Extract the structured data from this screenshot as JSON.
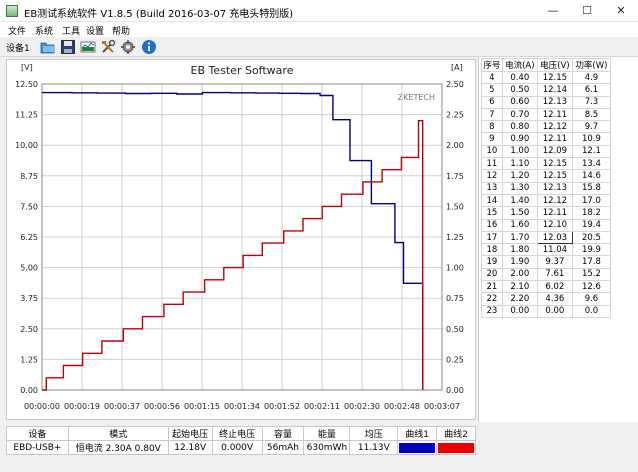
{
  "window": {
    "title": "EB测试系统软件 V1.8.5 (Build 2016-03-07 充电头特别版)",
    "minimize": "—",
    "maximize": "☐",
    "close": "✕"
  },
  "menu": [
    "文件",
    "系统",
    "工具",
    "设置",
    "帮助"
  ],
  "toolbar": {
    "device_label": "设备1",
    "buttons": [
      "open-icon",
      "save-icon",
      "chart-icon",
      "tools-icon",
      "settings-icon",
      "info-icon"
    ]
  },
  "chart_data": {
    "type": "line",
    "title": "EB Tester Software",
    "watermark": "ZKETECH",
    "y_left_unit": "[V]",
    "y_right_unit": "[A]",
    "y_left_ticks": [
      "0.00",
      "1.25",
      "2.50",
      "3.75",
      "5.00",
      "6.25",
      "7.50",
      "8.75",
      "10.00",
      "11.25",
      "12.50"
    ],
    "y_right_ticks": [
      "0.00",
      "0.25",
      "0.50",
      "0.75",
      "1.00",
      "1.25",
      "1.50",
      "1.75",
      "2.00",
      "2.25",
      "2.50"
    ],
    "x_ticks": [
      "00:00:00",
      "00:00:19",
      "00:00:37",
      "00:00:56",
      "00:01:15",
      "00:01:34",
      "00:01:52",
      "00:02:11",
      "00:02:30",
      "00:02:48",
      "00:03:07"
    ],
    "ylim_left": [
      0,
      12.5
    ],
    "ylim_right": [
      0,
      2.5
    ],
    "xlim_seconds": [
      0,
      187
    ],
    "grid": true,
    "series": [
      {
        "color": "#000080",
        "axis": "left",
        "x": [
          0,
          14,
          26,
          39,
          51,
          63,
          75,
          88,
          100,
          111,
          121,
          130,
          136,
          138,
          144,
          154,
          165,
          169,
          174,
          178
        ],
        "y": [
          12.15,
          12.14,
          12.13,
          12.11,
          12.12,
          12.09,
          12.15,
          12.14,
          12.13,
          12.12,
          12.11,
          12.03,
          11.04,
          11.04,
          9.37,
          7.61,
          6.02,
          4.36,
          4.36,
          0.0
        ]
      },
      {
        "color": "#c00000",
        "axis": "right",
        "x": [
          0,
          2,
          10,
          19,
          28,
          38,
          47,
          57,
          66,
          76,
          85,
          94,
          103,
          113,
          122,
          131,
          140,
          150,
          159,
          168,
          176,
          178
        ],
        "y": [
          0.0,
          0.1,
          0.2,
          0.3,
          0.4,
          0.5,
          0.6,
          0.7,
          0.8,
          0.9,
          1.0,
          1.1,
          1.2,
          1.3,
          1.4,
          1.5,
          1.6,
          1.7,
          1.8,
          1.9,
          2.2,
          0.0
        ]
      }
    ]
  },
  "table": {
    "headers": [
      "序号",
      "电流(A)",
      "电压(V)",
      "功率(W)"
    ],
    "rows": [
      [
        "4",
        "0.40",
        "12.15",
        "4.9"
      ],
      [
        "5",
        "0.50",
        "12.14",
        "6.1"
      ],
      [
        "6",
        "0.60",
        "12.13",
        "7.3"
      ],
      [
        "7",
        "0.70",
        "12.11",
        "8.5"
      ],
      [
        "8",
        "0.80",
        "12.12",
        "9.7"
      ],
      [
        "9",
        "0.90",
        "12.11",
        "10.9"
      ],
      [
        "10",
        "1.00",
        "12.09",
        "12.1"
      ],
      [
        "11",
        "1.10",
        "12.15",
        "13.4"
      ],
      [
        "12",
        "1.20",
        "12.15",
        "14.6"
      ],
      [
        "13",
        "1.30",
        "12.13",
        "15.8"
      ],
      [
        "14",
        "1.40",
        "12.12",
        "17.0"
      ],
      [
        "15",
        "1.50",
        "12.11",
        "18.2"
      ],
      [
        "16",
        "1.60",
        "12.10",
        "19.4"
      ],
      [
        "17",
        "1.70",
        "12.03",
        "20.5"
      ],
      [
        "18",
        "1.80",
        "11.04",
        "19.9"
      ],
      [
        "19",
        "1.90",
        "9.37",
        "17.8"
      ],
      [
        "20",
        "2.00",
        "7.61",
        "15.2"
      ],
      [
        "21",
        "2.10",
        "6.02",
        "12.6"
      ],
      [
        "22",
        "2.20",
        "4.36",
        "9.6"
      ],
      [
        "23",
        "0.00",
        "0.00",
        "0.0"
      ]
    ],
    "selected_row": 13
  },
  "summary": {
    "headers": [
      "设备",
      "模式",
      "起始电压",
      "终止电压",
      "容量",
      "能量",
      "均压",
      "曲线1",
      "曲线2"
    ],
    "values": [
      "EBD-USB+",
      "恒电流  2.30A  0.80V",
      "12.18V",
      "0.000V",
      "56mAh",
      "630mWh",
      "11.13V"
    ],
    "curve1_color": "#0000cc",
    "curve2_color": "#ee0000"
  }
}
